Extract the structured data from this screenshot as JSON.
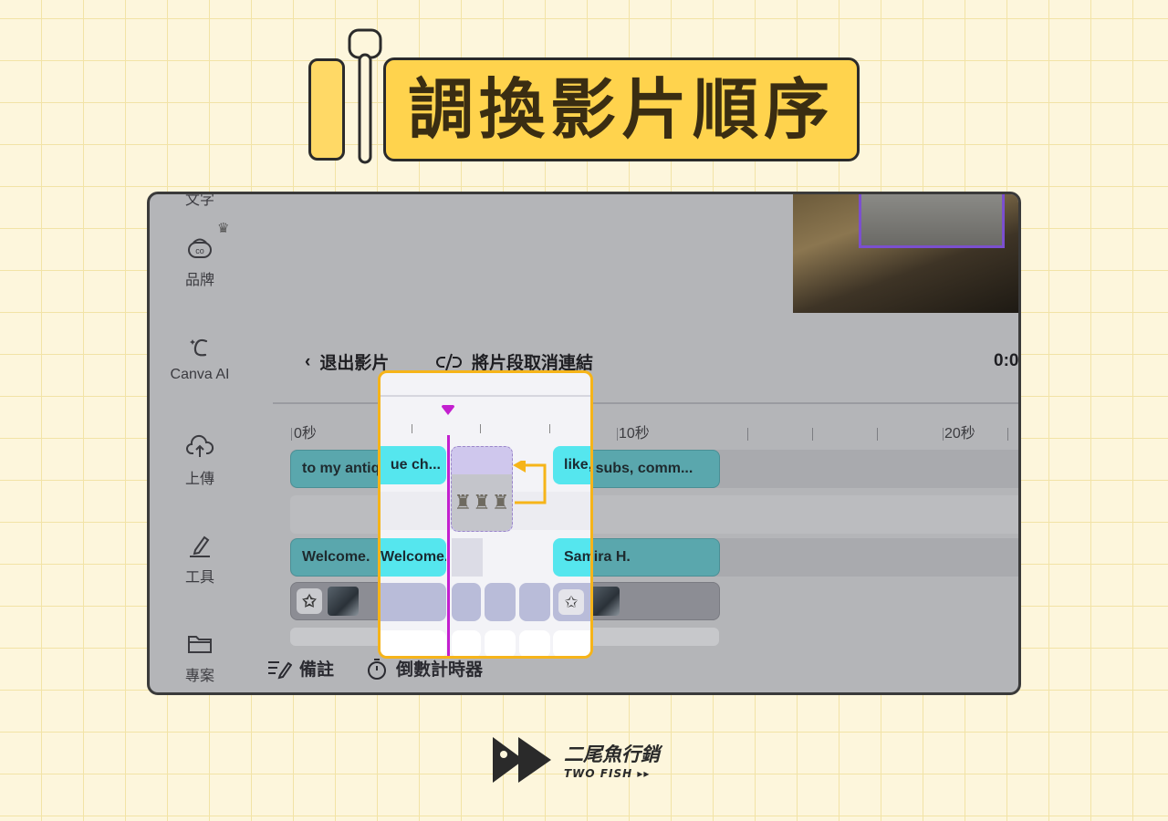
{
  "banner": {
    "title": "調換影片順序"
  },
  "sidebar": {
    "partial_top": "文字",
    "items": [
      {
        "label": "品牌",
        "icon": "brand-icon",
        "badge": "crown-icon"
      },
      {
        "label": "Canva AI",
        "icon": "canva-ai-icon"
      },
      {
        "label": "上傳",
        "icon": "upload-cloud-icon"
      },
      {
        "label": "工具",
        "icon": "pen-tool-icon"
      },
      {
        "label": "專案",
        "icon": "folder-icon"
      }
    ]
  },
  "toolbar": {
    "exit_video": "退出影片",
    "unlink_clips": "將片段取消連結",
    "time_partial": "0:0"
  },
  "ruler": {
    "labels": [
      "0秒",
      "10秒",
      "20秒"
    ]
  },
  "tracks": {
    "text_row1": [
      "to my antique ch...",
      "like, subs, comm..."
    ],
    "text_row3": [
      "Welcome.",
      "Samira H."
    ]
  },
  "zoom": {
    "clip_text": "ue ch...",
    "clip_text_right": "like, subs, comm...",
    "welcome_text": "Welcome.",
    "samira_text": "Samira H."
  },
  "bottom_bar": {
    "notes": "備註",
    "timer": "倒數計時器"
  },
  "logo": {
    "name": "二尾魚行銷",
    "sub": "TWO FISH ▸▸"
  },
  "colors": {
    "accent_yellow": "#ffd34d",
    "playhead": "#c31fcf",
    "callout_border": "#f6b419",
    "clip_teal": "#5aa7ad",
    "clip_cyan": "#55e6ee"
  }
}
